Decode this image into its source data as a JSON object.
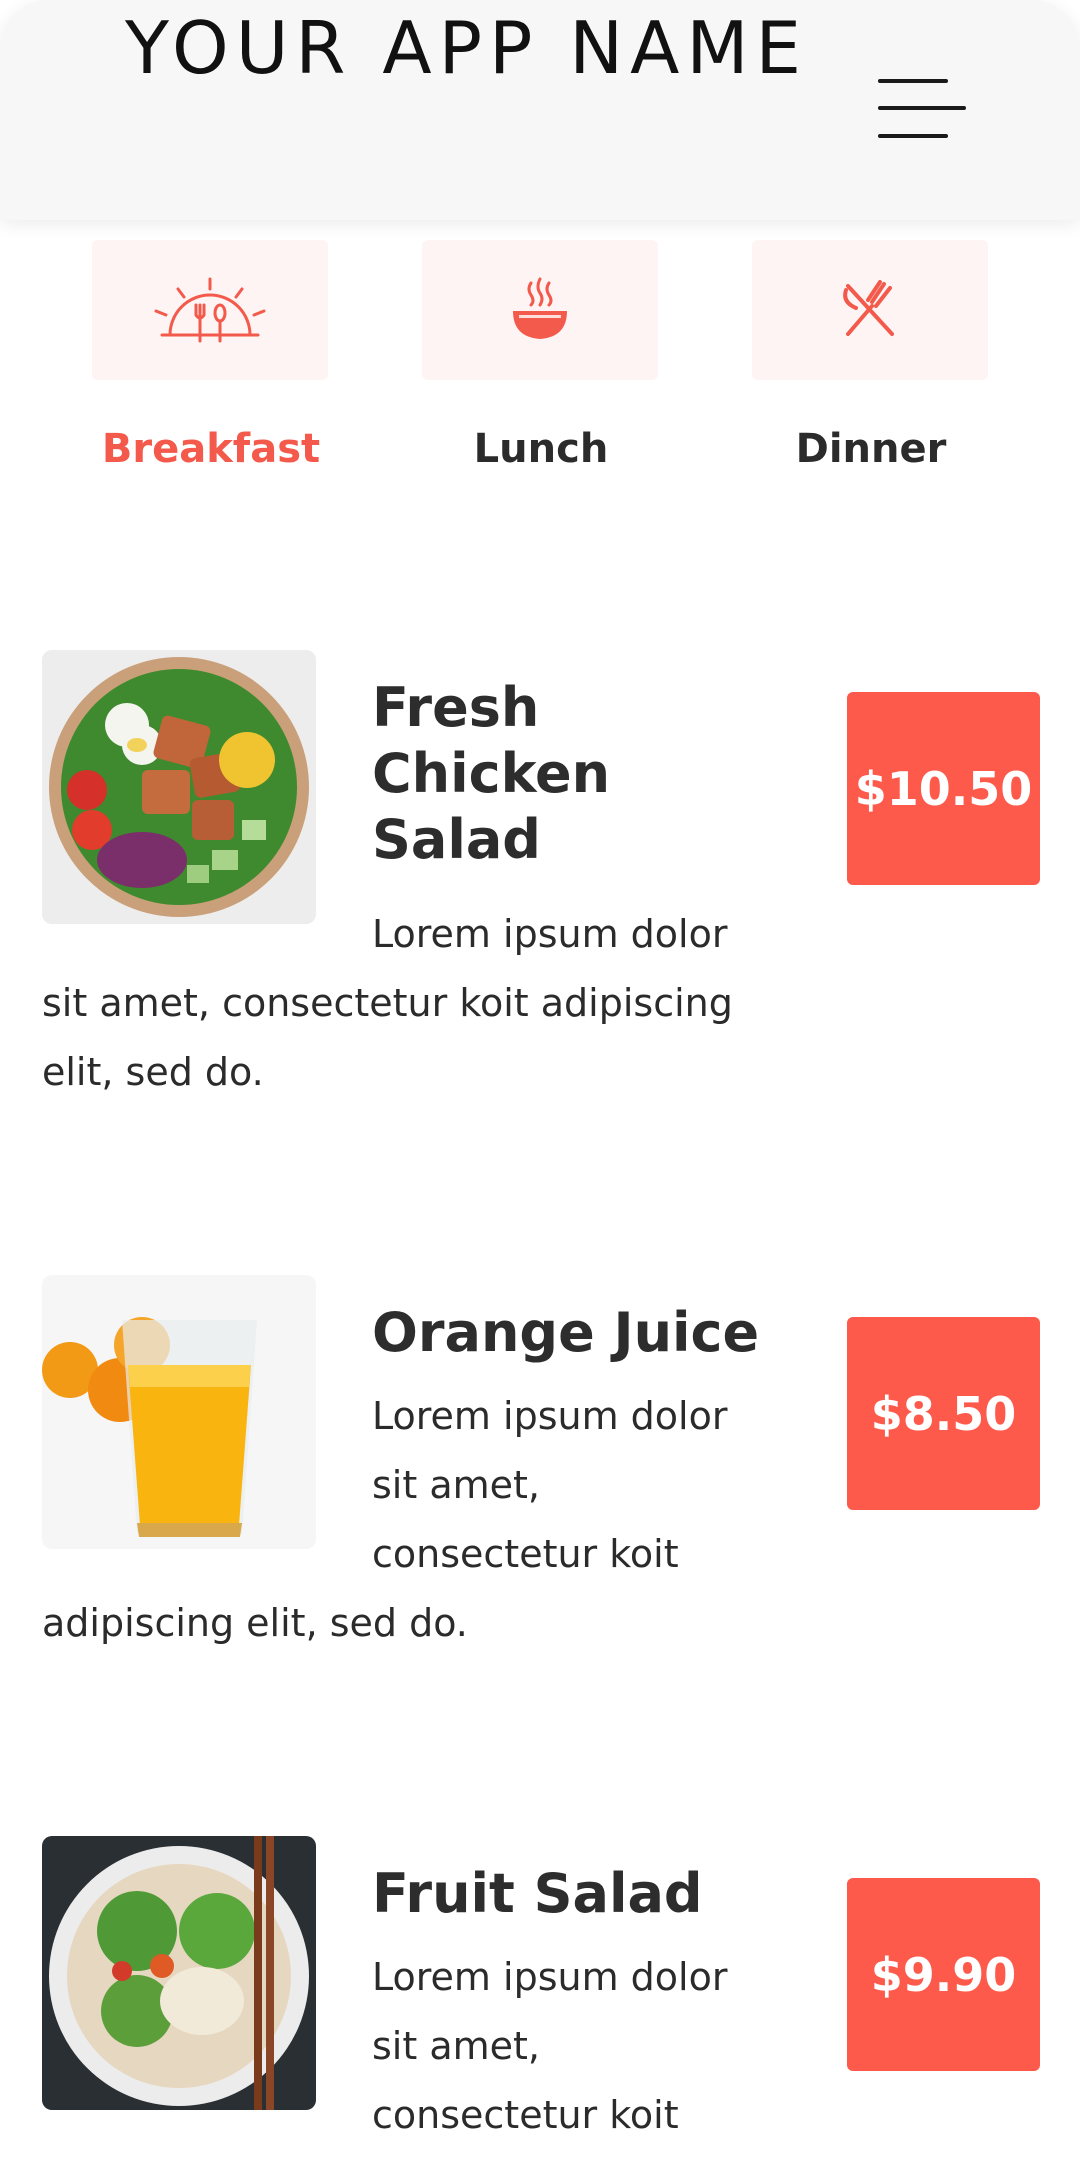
{
  "header": {
    "app_title": "YOUR APP NAME",
    "menu_icon": "hamburger-menu-icon"
  },
  "tabs": [
    {
      "label": "Breakfast",
      "icon": "sunrise-cutlery-icon",
      "active": true
    },
    {
      "label": "Lunch",
      "icon": "steaming-bowl-icon",
      "active": false
    },
    {
      "label": "Dinner",
      "icon": "fork-knife-icon",
      "active": false
    }
  ],
  "items": [
    {
      "name": "Fresh Chicken Salad",
      "description": "Lorem ipsum dolor sit amet, consectetur koit adipiscing elit, sed do.",
      "price": "$10.50",
      "image": "chicken-salad-bowl-image"
    },
    {
      "name": "Orange Juice",
      "description_lines": [
        "Lorem ipsum dolor",
        "sit amet,",
        "consectetur koit",
        "adipiscing elit, sed do."
      ],
      "price": "$8.50",
      "image": "orange-juice-glass-image"
    },
    {
      "name": "Fruit Salad",
      "description_lines": [
        "Lorem ipsum dolor",
        "sit amet,",
        "consectetur koit"
      ],
      "price": "$9.90",
      "image": "noodle-salad-bowl-image"
    }
  ],
  "colors": {
    "accent": "#fd5a4c",
    "active_tab": "#f35a4b",
    "header_bg": "#f7f7f7",
    "tab_bg": "#fdf4f3"
  }
}
